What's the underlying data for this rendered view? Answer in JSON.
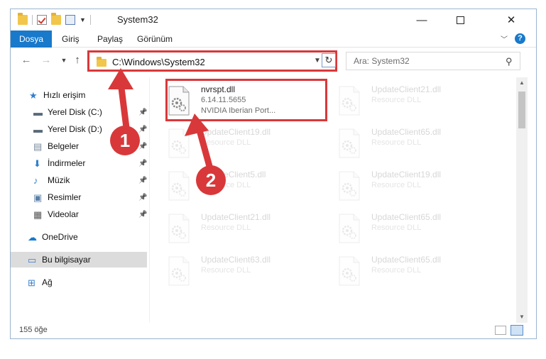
{
  "window": {
    "title": "System32",
    "controls": {
      "minimize": "—",
      "maximize": "",
      "close": "✕"
    }
  },
  "ribbon": {
    "tabs": [
      "Dosya",
      "Giriş",
      "Paylaş",
      "Görünüm"
    ],
    "help": "?"
  },
  "nav": {
    "address": "C:\\Windows\\System32",
    "search_placeholder": "Ara: System32"
  },
  "sidebar": {
    "items": [
      {
        "label": "Hızlı erişim",
        "icon": "star-icon",
        "pinned": false
      },
      {
        "label": "Yerel Disk (C:)",
        "icon": "drive-icon",
        "pinned": true
      },
      {
        "label": "Yerel Disk (D:)",
        "icon": "drive-icon",
        "pinned": true
      },
      {
        "label": "Belgeler",
        "icon": "documents-icon",
        "pinned": true
      },
      {
        "label": "İndirmeler",
        "icon": "download-icon",
        "pinned": true
      },
      {
        "label": "Müzik",
        "icon": "music-icon",
        "pinned": true
      },
      {
        "label": "Resimler",
        "icon": "pictures-icon",
        "pinned": true
      },
      {
        "label": "Videolar",
        "icon": "video-icon",
        "pinned": true
      },
      {
        "label": "OneDrive",
        "icon": "cloud-icon",
        "pinned": false
      },
      {
        "label": "Bu bilgisayar",
        "icon": "computer-icon",
        "pinned": false,
        "selected": true
      },
      {
        "label": "Ağ",
        "icon": "network-icon",
        "pinned": false
      }
    ]
  },
  "files": [
    {
      "name": "nvrspt.dll",
      "line1": "6.14.11.5655",
      "line2": "NVIDIA Iberian Port...",
      "highlighted": true
    },
    {
      "name": "UpdateClient21.dll",
      "line1": "Resource DLL",
      "line2": ""
    },
    {
      "name": "UpdateClient19.dll",
      "line1": "Resource DLL",
      "line2": ""
    },
    {
      "name": "UpdateClient65.dll",
      "line1": "Resource DLL",
      "line2": ""
    },
    {
      "name": "UpdateClient5.dll",
      "line1": "Resource DLL",
      "line2": ""
    },
    {
      "name": "UpdateClient19.dll",
      "line1": "Resource DLL",
      "line2": ""
    },
    {
      "name": "UpdateClient21.dll",
      "line1": "Resource DLL",
      "line2": ""
    },
    {
      "name": "UpdateClient65.dll",
      "line1": "Resource DLL",
      "line2": ""
    },
    {
      "name": "UpdateClient63.dll",
      "line1": "Resource DLL",
      "line2": ""
    },
    {
      "name": "UpdateClient65.dll",
      "line1": "Resource DLL",
      "line2": ""
    }
  ],
  "status": {
    "count": "155 öğe"
  },
  "annotations": {
    "callout1": "1",
    "callout2": "2",
    "color": "#d8383a"
  },
  "colors": {
    "accent": "#1979ca",
    "highlight": "#d8383a"
  }
}
